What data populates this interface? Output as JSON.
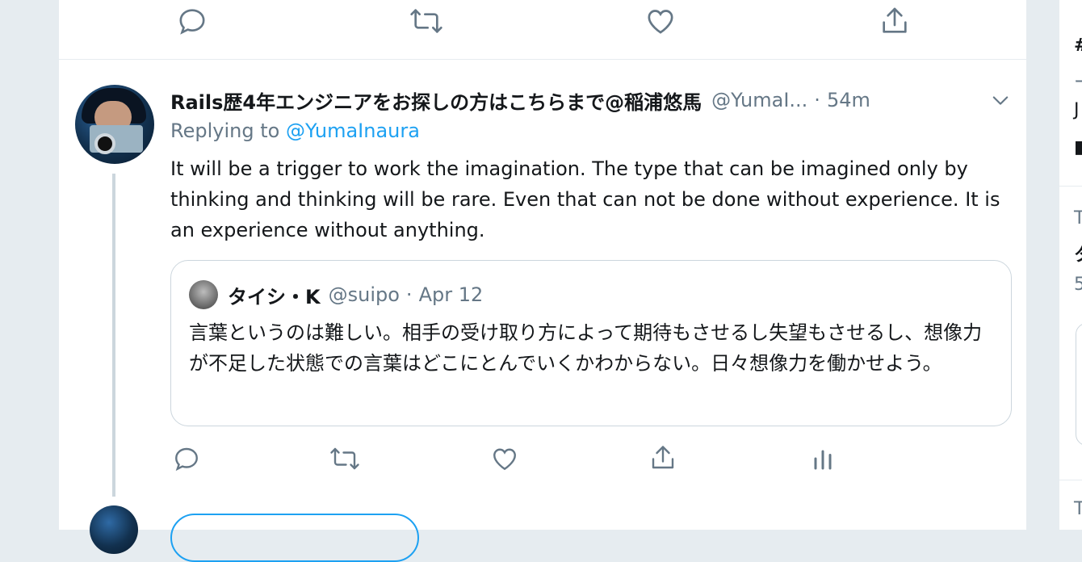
{
  "colors": {
    "accent": "#1da1f2",
    "secondary_text": "#657786",
    "primary_text": "#14171a",
    "border": "#e6ecf0",
    "quote_border": "#ccd6dd",
    "icon": "#657786"
  },
  "top_actions": {
    "icons": [
      "reply-icon",
      "retweet-icon",
      "like-icon",
      "share-icon"
    ]
  },
  "tweet": {
    "display_name": "Rails歴4年エンジニアをお探しの方はこちらまで@稲浦悠馬",
    "handle": "@YumaI...",
    "separator": "·",
    "time": "54m",
    "replying_prefix": "Replying to",
    "replying_mention": "@YumaInaura",
    "text": "It will be a trigger to work the imagination. The type that can be imagined only by thinking and thinking will be rare. Even that can not be done without experience. It is an experience without anything.",
    "quote": {
      "display_name": "タイシ・K",
      "handle": "@suipo",
      "separator": "·",
      "date": "Apr 12",
      "text": "言葉というのは難しい。相手の受け取り方によって期待もさせるし失望もさせるし、想像力が不足した状態での言葉はどこにとんでいくかわからない。日々想像力を働かせよう。"
    },
    "action_icons": [
      "reply-icon",
      "retweet-icon",
      "like-icon",
      "share-icon",
      "analytics-icon"
    ]
  },
  "right_sidebar": {
    "fragments": [
      "#",
      "ー",
      "J",
      "■",
      "T",
      "タ",
      "5",
      "T"
    ]
  }
}
